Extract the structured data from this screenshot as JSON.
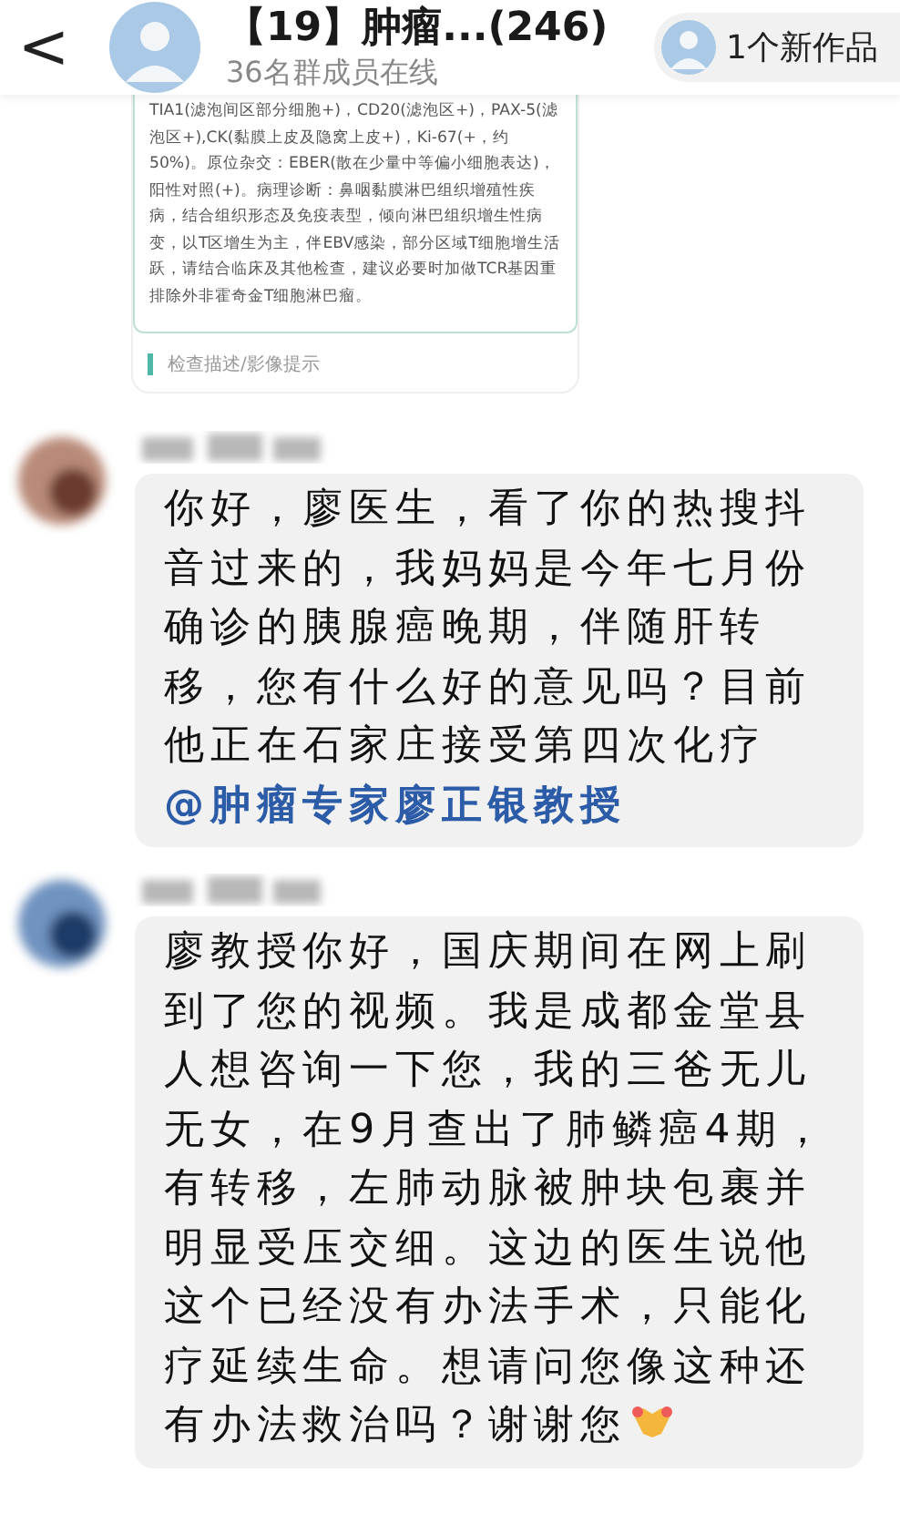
{
  "header": {
    "back_icon": "<",
    "title": "【19】肿瘤...(246)",
    "subtitle": "36名群成员在线",
    "new_works": "1个新作品"
  },
  "report_card": {
    "text": "TIA1(滤泡间区部分细胞+)，CD20(滤泡区+)，PAX-5(滤泡区+),CK(黏膜上皮及隐窝上皮+)，Ki-67(+，约50%)。原位杂交：EBER(散在少量中等偏小细胞表达)，阳性对照(+)。病理诊断：鼻咽黏膜淋巴组织增殖性疾病，结合组织形态及免疫表型，倾向淋巴组织增生性病变，以T区增生为主，伴EBV感染，部分区域T细胞增生活跃，请结合临床及其他检查，建议必要时加做TCR基因重排除外非霍奇金T细胞淋巴瘤。",
    "section_label": "检查描述/影像提示"
  },
  "messages": [
    {
      "text": "你好，廖医生，看了你的热搜抖音过来的，我妈妈是今年七月份确诊的胰腺癌晚期，伴随肝转移，您有什么好的意见吗？目前他正在石家庄接受第四次化疗",
      "mention": "@肿瘤专家廖正银教授",
      "emoji": false
    },
    {
      "text": "廖教授你好，国庆期间在网上刷到了您的视频。我是成都金堂县人想咨询一下您，我的三爸无儿无女，在9月查出了肺鳞癌4期，有转移，左肺动脉被肿块包裹并明显受压交细。这边的医生说他这个已经没有办法手术，只能化疗延续生命。想请问您像这种还有办法救治吗？谢谢您",
      "emoji": true
    }
  ]
}
